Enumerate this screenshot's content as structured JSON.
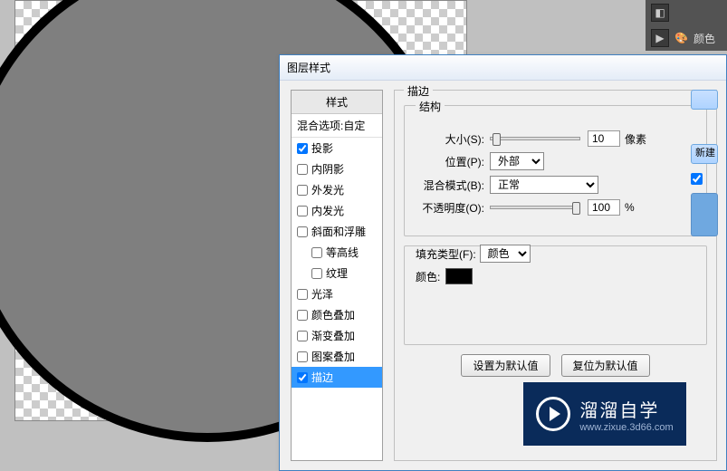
{
  "rightPanel": {
    "swatch_label": "颜色"
  },
  "dialog": {
    "title": "图层样式",
    "styles_header": "样式",
    "blend_options": "混合选项:自定",
    "items": [
      {
        "label": "投影",
        "checked": true,
        "selected": false,
        "indent": false
      },
      {
        "label": "内阴影",
        "checked": false,
        "selected": false,
        "indent": false
      },
      {
        "label": "外发光",
        "checked": false,
        "selected": false,
        "indent": false
      },
      {
        "label": "内发光",
        "checked": false,
        "selected": false,
        "indent": false
      },
      {
        "label": "斜面和浮雕",
        "checked": false,
        "selected": false,
        "indent": false
      },
      {
        "label": "等高线",
        "checked": false,
        "selected": false,
        "indent": true
      },
      {
        "label": "纹理",
        "checked": false,
        "selected": false,
        "indent": true
      },
      {
        "label": "光泽",
        "checked": false,
        "selected": false,
        "indent": false
      },
      {
        "label": "颜色叠加",
        "checked": false,
        "selected": false,
        "indent": false
      },
      {
        "label": "渐变叠加",
        "checked": false,
        "selected": false,
        "indent": false
      },
      {
        "label": "图案叠加",
        "checked": false,
        "selected": false,
        "indent": false
      },
      {
        "label": "描边",
        "checked": true,
        "selected": true,
        "indent": false
      }
    ],
    "stroke_title": "描边",
    "structure_title": "结构",
    "size_label": "大小(S):",
    "size_value": "10",
    "size_unit": "像素",
    "position_label": "位置(P):",
    "position_value": "外部",
    "blend_label": "混合模式(B):",
    "blend_value": "正常",
    "opacity_label": "不透明度(O):",
    "opacity_value": "100",
    "opacity_unit": "%",
    "fillType_label": "填充类型(F):",
    "fillType_value": "颜色",
    "color_label": "颜色:",
    "color_value": "#000000",
    "btn_default": "设置为默认值",
    "btn_reset": "复位为默认值",
    "side_new": "新建"
  },
  "watermark": {
    "main": "溜溜自学",
    "sub": "www.zixue.3d66.com"
  }
}
